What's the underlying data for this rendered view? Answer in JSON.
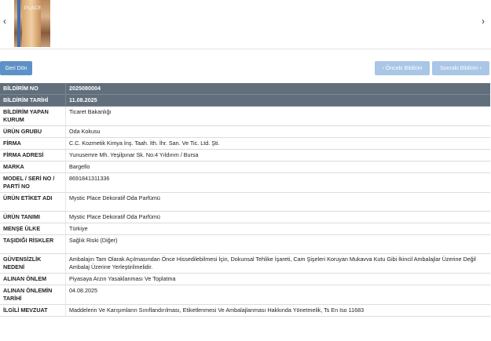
{
  "gallery": {
    "thumb_text": "PLACE",
    "prev_arrow": "‹",
    "next_arrow": "›"
  },
  "buttons": {
    "back": "Geri Dön",
    "prev": "‹ Önceki Bildirim",
    "next": "Sonraki Bildirim ›"
  },
  "rows": [
    {
      "key": "BİLDİRİM NO",
      "value": "2025080004",
      "h": 13
    },
    {
      "key": "BİLDİRİM TARİHİ",
      "value": "11.08.2025",
      "h": 13
    },
    {
      "key": "BİLDİRİM YAPAN KURUM",
      "value": "Ticaret Bakanlığı",
      "h": 24
    },
    {
      "key": "ÜRÜN GRUBU",
      "value": "Oda Kokusu",
      "h": 13
    },
    {
      "key": "FİRMA",
      "value": "C.C. Kozmetik Kimya İnş. Taah. İth. İhr. San. Ve Tic. Ltd. Şti.",
      "h": 13
    },
    {
      "key": "FİRMA ADRESİ",
      "value": "Yunusemre Mh. Yeşilpınar Sk. No:4 Yıldırım / Bursa",
      "h": 13
    },
    {
      "key": "MARKA",
      "value": "Bargello",
      "h": 13
    },
    {
      "key": "MODEL / SERİ NO / PARTİ NO",
      "value": "8691841311336",
      "h": 24
    },
    {
      "key": "ÜRÜN ETİKET ADI",
      "value": "Mystic Place Dekoratif Oda Parfümü",
      "h": 24
    },
    {
      "key": "ÜRÜN TANIMI",
      "value": "Mystic Place Dekoratif Oda Parfümü",
      "h": 13
    },
    {
      "key": "MENŞE ÜLKE",
      "value": "Türkiye",
      "h": 13
    },
    {
      "key": "TAŞIDIĞI RİSKLER",
      "value": "Sağlık Riski (Diğer)",
      "h": 24
    },
    {
      "key": "GÜVENSİZLİK NEDENİ",
      "value": "Ambalajın Tam Olarak Açılmasından Önce Hissedilebilmesi İçin, Dokunsal Tehlike İşareti, Cam Şişeleri Koruyan Mukavva Kutu Gibi İkincil Ambalajlar Üzerine Değil Ambalaj Üzerine Yerleştirilmelidir.",
      "h": 24
    },
    {
      "key": "ALINAN ÖNLEM",
      "value": "Piyasaya Arzın Yasaklanması Ve Toplatma",
      "h": 13
    },
    {
      "key": "ALINAN ÖNLEMİN TARİHİ",
      "value": "04.08.2025",
      "h": 24
    },
    {
      "key": "İLGİLİ MEVZUAT",
      "value": "Maddelerin Ve Karışımların Sınıflandırılması, Etiketlenmesi Ve Ambalajlanması Hakkında Yönetmelik, Ts En Iso 11683",
      "h": 13
    }
  ]
}
